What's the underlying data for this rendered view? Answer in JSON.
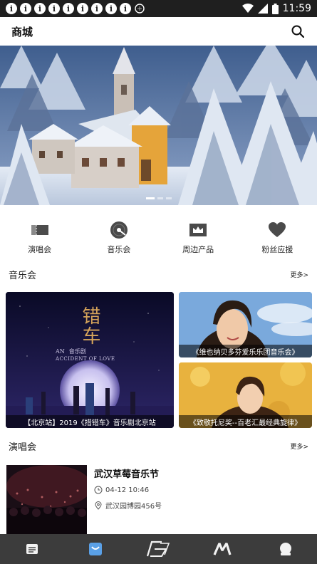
{
  "status_bar": {
    "time": "11:59"
  },
  "app_bar": {
    "title": "商城"
  },
  "categories": [
    {
      "label": "演唱会",
      "icon": "ticket-icon"
    },
    {
      "label": "音乐会",
      "icon": "vinyl-disc-icon"
    },
    {
      "label": "周边产品",
      "icon": "crown-icon"
    },
    {
      "label": "粉丝应援",
      "icon": "heart-icon"
    }
  ],
  "music_section": {
    "title": "音乐会",
    "more": "更多>",
    "cards": [
      {
        "caption": "【北京站】2019《措错车》音乐剧北京站",
        "poster_title": "错车",
        "poster_sub_en": "ACCIDENT OF LOVE",
        "poster_sub_cn": "音乐剧",
        "poster_an": "AN"
      },
      {
        "caption": "《维也纳贝多芬爱乐乐团音乐会》"
      },
      {
        "caption": "《致敬托尼奖--百老汇最经典旋律》"
      }
    ]
  },
  "live_section": {
    "title": "演唱会",
    "more": "更多>",
    "item": {
      "title": "武汉草莓音乐节",
      "date": "04-12 10:46",
      "location": "武汉园博园456号"
    }
  },
  "bottom_nav": [
    {
      "icon": "calendar-list-icon"
    },
    {
      "icon": "shop-bag-icon"
    },
    {
      "icon": "brand-logo-icon"
    },
    {
      "icon": "m-logo-icon"
    },
    {
      "icon": "profile-icon"
    }
  ],
  "colors": {
    "status_bar": "#1f1f1f",
    "bottom_nav": "#3c3c3c",
    "accent_nav": "#5aa0e6"
  }
}
